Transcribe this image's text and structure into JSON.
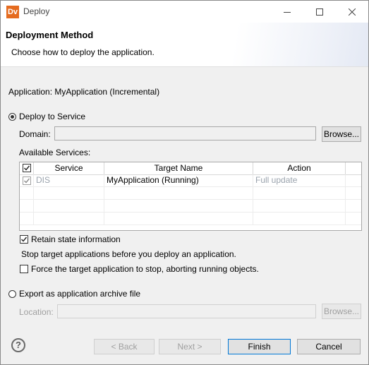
{
  "window": {
    "app_icon_text": "Dv",
    "title": "Deploy"
  },
  "header": {
    "title": "Deployment Method",
    "description": "Choose how to deploy the application."
  },
  "application_label": "Application: MyApplication (Incremental)",
  "deploy_service": {
    "label": "Deploy to Service",
    "selected": true,
    "domain_label": "Domain:",
    "domain_value": "",
    "browse_label": "Browse...",
    "available_label": "Available Services:",
    "columns": [
      "Service",
      "Target Name",
      "Action"
    ],
    "rows": [
      {
        "checked": true,
        "service": "DIS",
        "target": "MyApplication (Running)",
        "action": "Full update"
      }
    ]
  },
  "options": {
    "retain_label": "Retain state information",
    "retain_checked": true,
    "stop_text": "Stop target applications before you deploy an application.",
    "force_label": "Force the target application to stop, aborting running objects.",
    "force_checked": false
  },
  "export": {
    "label": "Export as application archive file",
    "selected": false,
    "location_label": "Location:",
    "location_value": "",
    "browse_label": "Browse..."
  },
  "footer": {
    "back_label": "< Back",
    "next_label": "Next >",
    "finish_label": "Finish",
    "cancel_label": "Cancel"
  },
  "colors": {
    "accent": "#0078d7",
    "app_icon": "#e56b1f",
    "disabled_text": "#9aa3ad"
  }
}
